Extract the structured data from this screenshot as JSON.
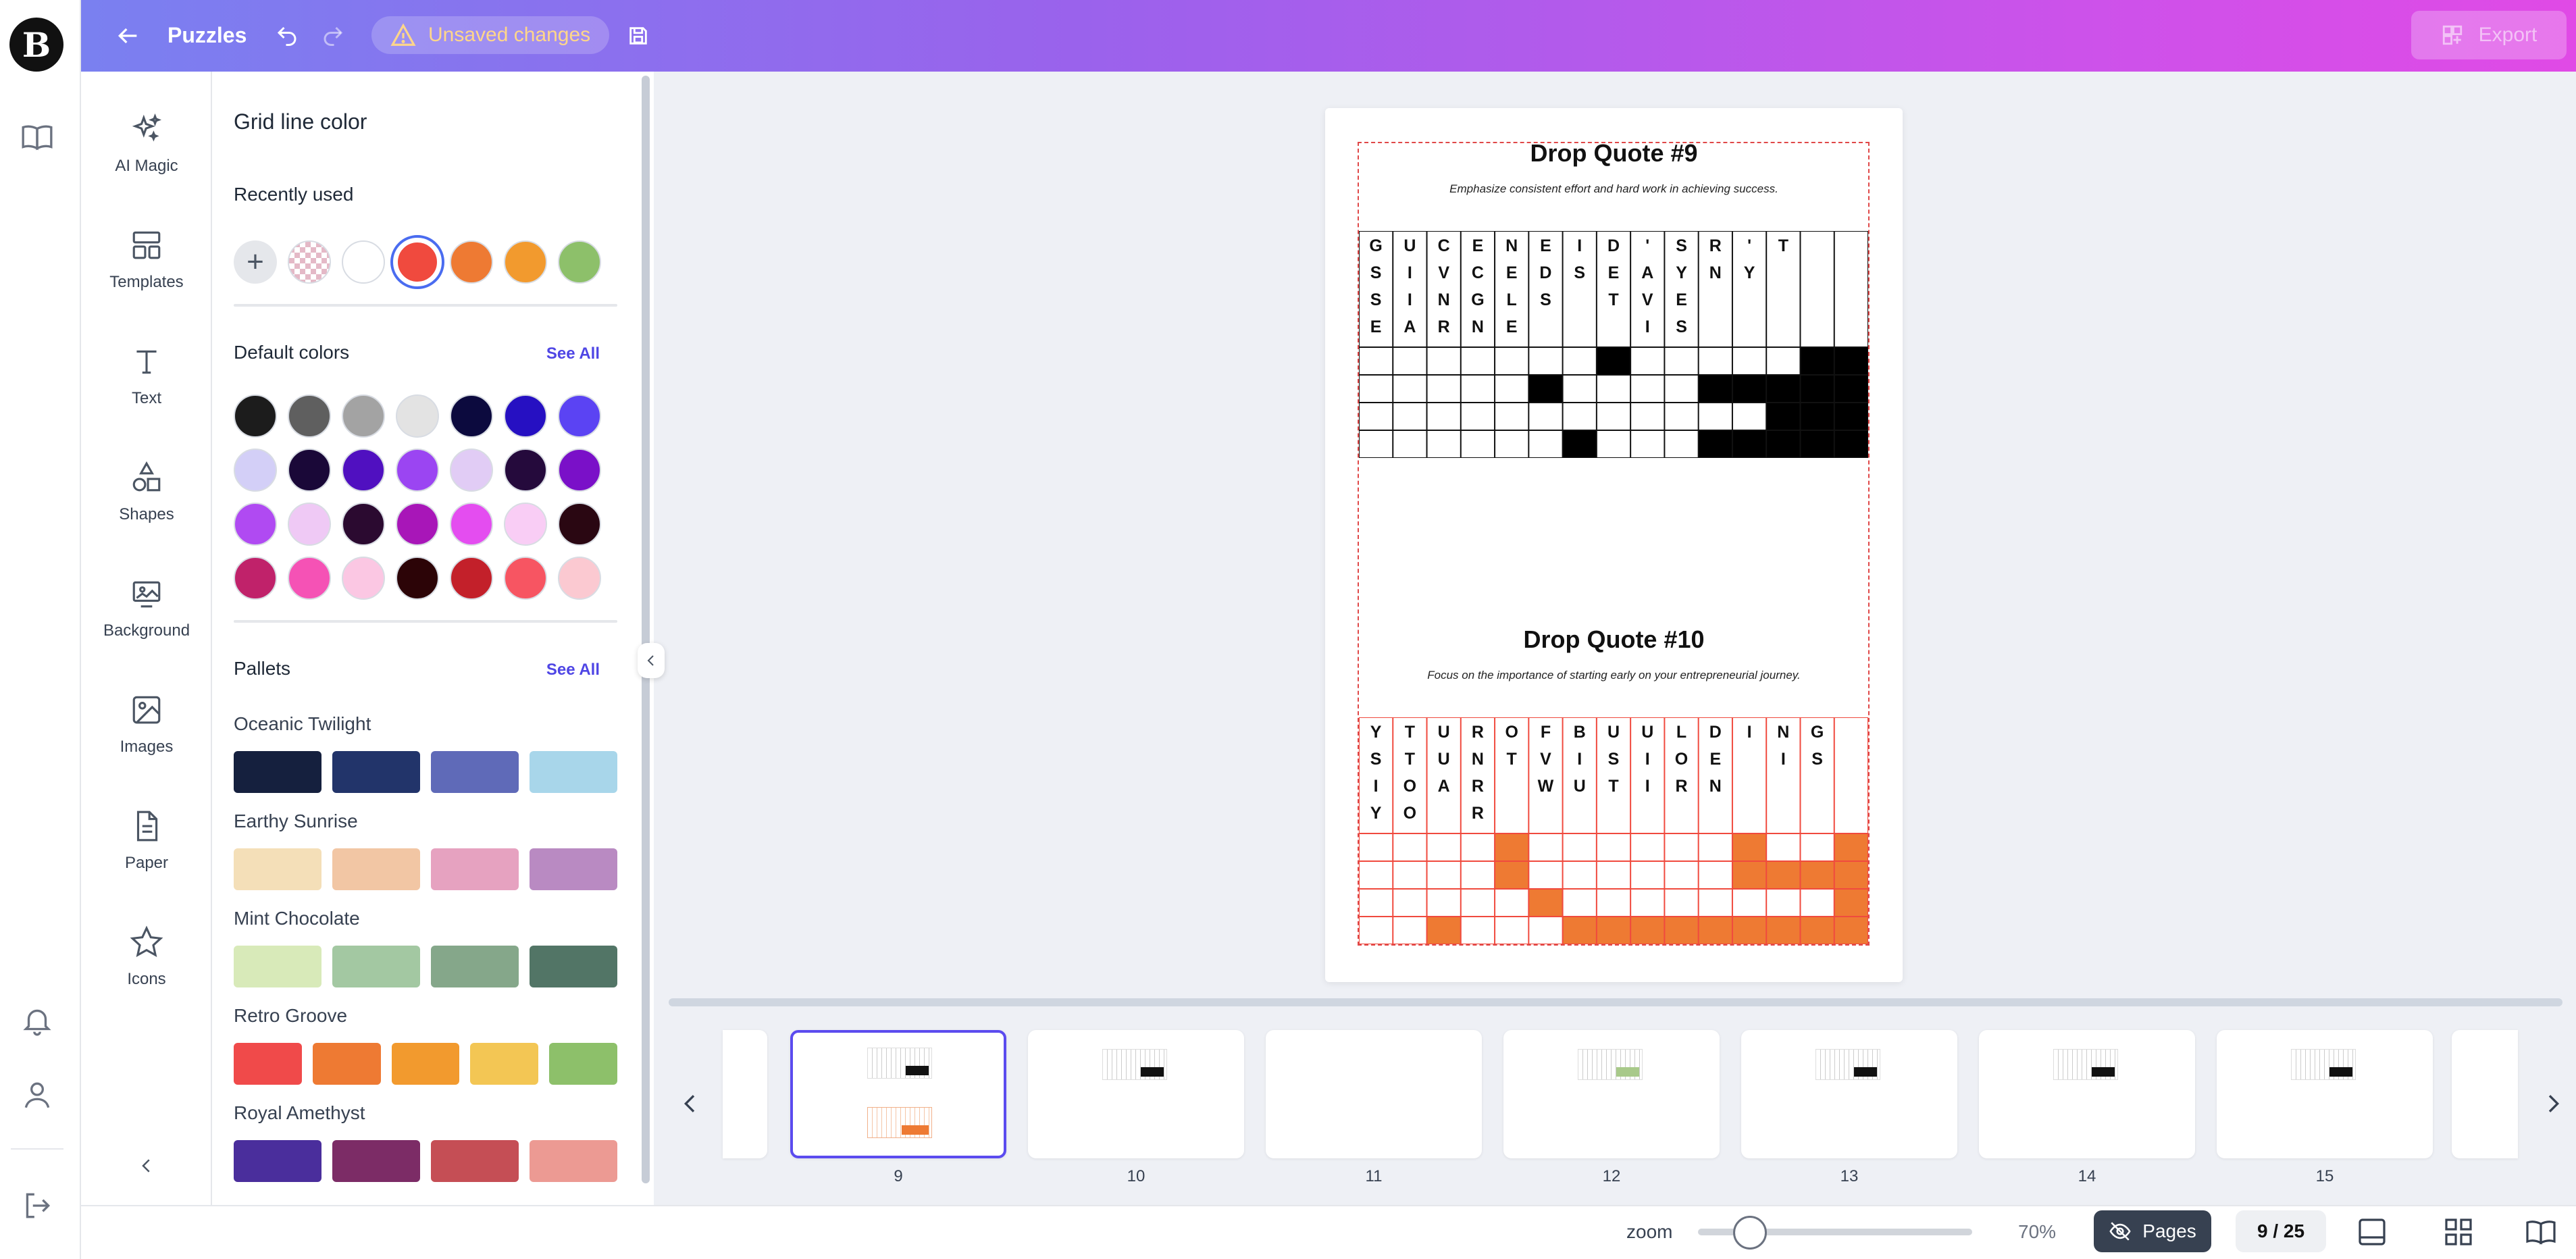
{
  "rail": {
    "logo_letter": "B"
  },
  "topbar": {
    "title": "Puzzles",
    "unsaved": "Unsaved changes",
    "export": "Export"
  },
  "tools": [
    {
      "label": "AI Magic",
      "icon": "sparkle-icon"
    },
    {
      "label": "Templates",
      "icon": "templates-icon"
    },
    {
      "label": "Text",
      "icon": "text-icon"
    },
    {
      "label": "Shapes",
      "icon": "shapes-icon"
    },
    {
      "label": "Background",
      "icon": "background-icon"
    },
    {
      "label": "Images",
      "icon": "image-icon"
    },
    {
      "label": "Paper",
      "icon": "paper-icon"
    },
    {
      "label": "Icons",
      "icon": "star-icon"
    }
  ],
  "panel": {
    "title": "Grid line color",
    "recent_title": "Recently used",
    "recent_colors": [
      "transparent",
      "#ffffff",
      "#f04a3e",
      "#ee7a33",
      "#f29a2e",
      "#8dc06a"
    ],
    "recent_selected": "#f04a3e",
    "default_title": "Default colors",
    "see_all": "See All",
    "default_colors": [
      "#1c1c1c",
      "#5f5f5f",
      "#a3a3a3",
      "#e3e3e3",
      "#0c0a3e",
      "#2610c2",
      "#5b43f3",
      "#d3cff7",
      "#1a0838",
      "#5010c0",
      "#9b45f2",
      "#e1ccf5",
      "#250a3c",
      "#7a10c8",
      "#b04af2",
      "#efc9f5",
      "#2b0a30",
      "#a816b8",
      "#e44df0",
      "#f9cdf5",
      "#2a0712",
      "#c0226a",
      "#f552b5",
      "#fbc7e3",
      "#2c0407",
      "#c3202a",
      "#f75562",
      "#fbc9d1"
    ],
    "pallets_title": "Pallets",
    "pallets": [
      {
        "name": "Oceanic Twilight",
        "colors": [
          "#15203e",
          "#22346a",
          "#5f6ab8",
          "#a8d6ea"
        ]
      },
      {
        "name": "Earthy Sunrise",
        "colors": [
          "#f4dfb8",
          "#f2c6a4",
          "#e6a2c0",
          "#b98ac2"
        ]
      },
      {
        "name": "Mint Chocolate",
        "colors": [
          "#d8eab9",
          "#a3c8a2",
          "#85a78a",
          "#527566"
        ]
      },
      {
        "name": "Retro Groove",
        "colors": [
          "#f04a4a",
          "#ee7a33",
          "#f29a2e",
          "#f3c654",
          "#8dc06a"
        ]
      },
      {
        "name": "Royal Amethyst",
        "colors": [
          "#4a2e9c",
          "#7c2c66",
          "#c54e55",
          "#ec9a93"
        ]
      }
    ]
  },
  "canvas": {
    "puzzle1": {
      "title": "Drop Quote #9",
      "subtitle": "Emphasize consistent effort and hard work in achieving success.",
      "letter_columns": [
        [
          "G",
          "S",
          "S",
          "E"
        ],
        [
          "U",
          "I",
          "I",
          "A"
        ],
        [
          "C",
          "V",
          "N",
          "R"
        ],
        [
          "E",
          "C",
          "G",
          "N"
        ],
        [
          "N",
          "E",
          "L",
          "E"
        ],
        [
          "E",
          "D",
          "S"
        ],
        [
          "I",
          "S"
        ],
        [
          "D",
          "E",
          "T"
        ],
        [
          "'",
          "A",
          "V",
          "I"
        ],
        [
          "S",
          "Y",
          "E",
          "S"
        ],
        [
          "R",
          "N"
        ],
        [
          "'",
          "Y"
        ],
        [
          "T"
        ],
        [],
        []
      ],
      "fill_color": "#000000",
      "black_cells": [
        [
          7,
          0
        ],
        [
          13,
          0
        ],
        [
          14,
          0
        ],
        [
          5,
          1
        ],
        [
          10,
          1
        ],
        [
          11,
          1
        ],
        [
          12,
          1
        ],
        [
          13,
          1
        ],
        [
          14,
          1
        ],
        [
          12,
          2
        ],
        [
          13,
          2
        ],
        [
          14,
          2
        ],
        [
          6,
          3
        ],
        [
          10,
          3
        ],
        [
          11,
          3
        ],
        [
          12,
          3
        ],
        [
          13,
          3
        ],
        [
          14,
          3
        ]
      ]
    },
    "puzzle2": {
      "title": "Drop Quote #10",
      "subtitle": "Focus on the importance of starting early on your entrepreneurial journey.",
      "letter_columns": [
        [
          "Y",
          "S",
          "I",
          "Y"
        ],
        [
          "T",
          "T",
          "O",
          "O"
        ],
        [
          "U",
          "U",
          "A"
        ],
        [
          "R",
          "N",
          "R",
          "R"
        ],
        [
          "O",
          "T"
        ],
        [
          "F",
          "V",
          "W"
        ],
        [
          "B",
          "I",
          "U"
        ],
        [
          "U",
          "S",
          "T"
        ],
        [
          "U",
          "I",
          "I"
        ],
        [
          "L",
          "O",
          "R"
        ],
        [
          "D",
          "E",
          "N"
        ],
        [
          "I"
        ],
        [
          "N",
          "I"
        ],
        [
          "G",
          "S"
        ],
        []
      ],
      "fill_color": "#ee7a33",
      "black_cells": [
        [
          4,
          0
        ],
        [
          11,
          0
        ],
        [
          14,
          0
        ],
        [
          4,
          1
        ],
        [
          11,
          1
        ],
        [
          12,
          1
        ],
        [
          13,
          1
        ],
        [
          14,
          1
        ],
        [
          5,
          2
        ],
        [
          14,
          2
        ],
        [
          2,
          3
        ],
        [
          6,
          3
        ],
        [
          7,
          3
        ],
        [
          8,
          3
        ],
        [
          9,
          3
        ],
        [
          10,
          3
        ],
        [
          11,
          3
        ],
        [
          12,
          3
        ],
        [
          13,
          3
        ],
        [
          14,
          3
        ]
      ]
    }
  },
  "thumbnails": [
    {
      "num": "9",
      "selected": true
    },
    {
      "num": "10"
    },
    {
      "num": "11"
    },
    {
      "num": "12"
    },
    {
      "num": "13"
    },
    {
      "num": "14"
    },
    {
      "num": "15"
    }
  ],
  "bottombar": {
    "zoom_label": "zoom",
    "zoom_value": "70%",
    "zoom_fraction": 0.19,
    "pages_label": "Pages",
    "page_count": "9 / 25"
  }
}
